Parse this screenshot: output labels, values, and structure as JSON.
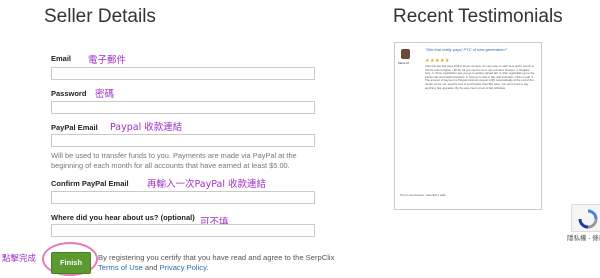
{
  "seller": {
    "title": "Seller Details",
    "email_label": "Email",
    "password_label": "Password",
    "paypal_label": "PayPal Email",
    "paypal_help": "Will be used to transfer funds to you. Payments are made via PayPal at the beginning of each month for all accounts that have earned at least $5.00.",
    "confirm_label": "Confirm PayPal Email",
    "hear_label": "Where did you hear about us? (optional)",
    "finish_label": "Finish",
    "terms_prefix": "By registering you certify that you have read and agree to the SerpClix ",
    "terms_link": "Terms of Use",
    "terms_and": " and ",
    "privacy_link": "Privacy Policy",
    "terms_suffix": "."
  },
  "annotations": {
    "email": "電子郵件",
    "password": "密碼",
    "paypal": "Paypal 收款連結",
    "confirm": "再輸入一次PayPal 收款連結",
    "optional": "可不填",
    "finish": "點擊完成"
  },
  "testimonials": {
    "title": "Recent Testimonials",
    "quote": "\"Site that really pays! PTC of new generation!\"",
    "user_name": "Marie M.",
    "body": "I like this site that pays 0.06-0.10 per ad view. It's very easy to earn here and it counts to US the ratio is higher - $0.10. All you need to do is use a Firefox browser: 1. Register here. 2. Once registration was you go to getting started tab. 3. After registration go to the Firefox tab and install extension. 4. Now go to ads or tab, add extension, click on ads. 5. The amount of payment is Paypal minimum payout is $5. Automatically at the end of the month. As for me, serpclix.com is much better than Bux sites. You don't need to pay anything, like upgrades. By the way, here's proof of last withdraw.",
    "footer": "Tip for commenters: Just click it well!"
  },
  "captcha": {
    "text": "隱私權 - 條款"
  },
  "colors": {
    "finish_green": "#5a9a2f",
    "annotation_purple": "#a030c8",
    "highlight_pink": "#e87ab8",
    "link_blue": "#2b6cb0"
  }
}
